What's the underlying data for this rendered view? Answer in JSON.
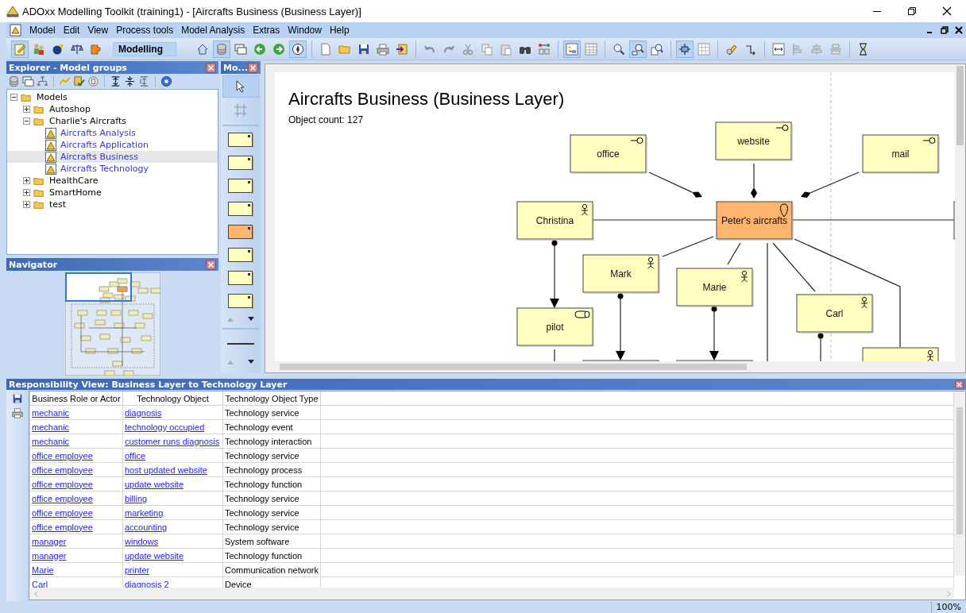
{
  "window": {
    "title": "ADOxx Modelling Toolkit (training1) - [Aircrafts Business (Business Layer)]"
  },
  "menu": [
    "Model",
    "Edit",
    "View",
    "Process tools",
    "Model Analysis",
    "Extras",
    "Window",
    "Help"
  ],
  "toolbar": [
    {
      "kind": "buttons",
      "items": [
        {
          "pressed": true
        },
        {
          "pressed": false
        },
        {
          "pressed": false
        },
        {
          "pressed": false
        },
        {
          "pressed": false
        }
      ]
    },
    {
      "kind": "mode",
      "label": "Modelling"
    },
    {
      "kind": "buttons",
      "items": [
        {
          "pressed": false
        },
        {
          "pressed": true
        },
        {
          "pressed": false
        },
        {
          "pressed": false
        },
        {
          "pressed": false
        },
        {
          "pressed": true
        }
      ]
    },
    {
      "kind": "buttons",
      "items": [
        {
          "pressed": false
        },
        {
          "pressed": false
        },
        {
          "pressed": false
        },
        {
          "pressed": false
        },
        {
          "pressed": false
        }
      ]
    },
    {
      "kind": "buttons",
      "items": [
        {
          "pressed": false
        },
        {
          "pressed": false
        },
        {
          "pressed": false
        },
        {
          "pressed": false
        },
        {
          "pressed": false
        },
        {
          "pressed": false
        },
        {
          "pressed": false
        }
      ]
    },
    {
      "kind": "buttons",
      "items": [
        {
          "pressed": true
        },
        {
          "pressed": false
        }
      ]
    },
    {
      "kind": "buttons",
      "items": [
        {
          "pressed": false
        },
        {
          "pressed": true
        },
        {
          "pressed": false
        }
      ]
    },
    {
      "kind": "buttons",
      "items": [
        {
          "pressed": true
        },
        {
          "pressed": false
        }
      ]
    },
    {
      "kind": "buttons",
      "items": [
        {
          "pressed": false
        },
        {
          "pressed": false
        }
      ]
    },
    {
      "kind": "buttons",
      "items": [
        {
          "pressed": false
        },
        {
          "pressed": false
        },
        {
          "pressed": false
        },
        {
          "pressed": false
        }
      ]
    },
    {
      "kind": "buttons",
      "items": [
        {
          "pressed": false
        }
      ]
    }
  ],
  "explorer": {
    "title": "Explorer - Model groups",
    "tree": [
      {
        "label": "Models",
        "kind": "folder",
        "expanded": true,
        "selected": false,
        "children": [
          {
            "label": "Autoshop",
            "kind": "folder",
            "expanded": false,
            "selected": false
          },
          {
            "label": "Charlie's Aircrafts",
            "kind": "folder",
            "expanded": true,
            "selected": false,
            "children": [
              {
                "label": "Aircrafts Analysis",
                "kind": "model",
                "selected": false
              },
              {
                "label": "Aircrafts Application",
                "kind": "model",
                "selected": false
              },
              {
                "label": "Aircrafts Business",
                "kind": "model",
                "selected": true
              },
              {
                "label": "Aircrafts Technology",
                "kind": "model",
                "selected": false
              }
            ]
          },
          {
            "label": "HealthCare",
            "kind": "folder",
            "expanded": false,
            "selected": false
          },
          {
            "label": "SmartHome",
            "kind": "folder",
            "expanded": false,
            "selected": false
          },
          {
            "label": "test",
            "kind": "folder",
            "expanded": false,
            "selected": false
          }
        ]
      }
    ]
  },
  "navigator": {
    "title": "Navigator"
  },
  "palette": {
    "title": "Mo...",
    "tools": [
      {
        "kind": "pointer",
        "selected": true
      },
      {
        "kind": "grid",
        "selected": false
      },
      {
        "kind": "element",
        "selected": false,
        "color": "#ffffc0"
      },
      {
        "kind": "element",
        "selected": false,
        "color": "#ffffc0"
      },
      {
        "kind": "element",
        "selected": false,
        "color": "#ffffc0"
      },
      {
        "kind": "element",
        "selected": false,
        "color": "#ffffc0"
      },
      {
        "kind": "element",
        "selected": false,
        "color": "#fdb46e"
      },
      {
        "kind": "element",
        "selected": false,
        "color": "#ffffc0"
      },
      {
        "kind": "element",
        "selected": false,
        "color": "#ffffc0"
      },
      {
        "kind": "element",
        "selected": false,
        "color": "#ffffc0"
      },
      {
        "kind": "line",
        "selected": false
      }
    ]
  },
  "diagram": {
    "title": "Aircrafts Business (Business Layer)",
    "subtitle": "Object count: 127",
    "nodes": [
      {
        "label": "office",
        "kind": "service",
        "color": "#ffffc0"
      },
      {
        "label": "website",
        "kind": "service",
        "color": "#ffffc0"
      },
      {
        "label": "mail",
        "kind": "service",
        "color": "#ffffc0"
      },
      {
        "label": "Christina",
        "kind": "actor",
        "color": "#ffffc0"
      },
      {
        "label": "Peter's aircrafts",
        "kind": "location",
        "color": "#fdb46e"
      },
      {
        "label": "Mark",
        "kind": "actor",
        "color": "#ffffc0"
      },
      {
        "label": "Marie",
        "kind": "actor",
        "color": "#ffffc0"
      },
      {
        "label": "pilot",
        "kind": "role",
        "color": "#ffffc0"
      },
      {
        "label": "Carl",
        "kind": "actor",
        "color": "#ffffc0"
      },
      {
        "kind": "actor",
        "color": "#ffffc0"
      },
      {
        "kind": "box"
      },
      {
        "kind": "box"
      },
      {
        "kind": "box"
      }
    ],
    "connections": [
      {
        "kind": "aggregation"
      },
      {
        "kind": "aggregation"
      },
      {
        "kind": "aggregation"
      },
      {
        "kind": "association"
      },
      {
        "kind": "association"
      },
      {
        "kind": "association"
      },
      {
        "kind": "association"
      },
      {
        "kind": "association"
      },
      {
        "kind": "association"
      },
      {
        "kind": "association"
      },
      {
        "kind": "assignment"
      },
      {
        "kind": "assignment"
      },
      {
        "kind": "assignment"
      },
      {
        "kind": "assignment"
      },
      {
        "kind": "association"
      }
    ]
  },
  "responsibility_view": {
    "title": "Responsibility View: Business Layer to Technology Layer",
    "columns": [
      "Business Role or Actor",
      "Technology Object",
      "Technology Object Type"
    ],
    "rows": [
      {
        "role": "mechanic",
        "object": "diagnosis",
        "type": "Technology service"
      },
      {
        "role": "mechanic",
        "object": "technology occupied",
        "type": "Technology event"
      },
      {
        "role": "mechanic",
        "object": "customer runs diagnosis",
        "type": "Technology interaction"
      },
      {
        "role": "office employee",
        "object": "office",
        "type": "Technology service"
      },
      {
        "role": "office employee",
        "object": "host updated website",
        "type": "Technology process"
      },
      {
        "role": "office employee",
        "object": "update website",
        "type": "Technology function"
      },
      {
        "role": "office employee",
        "object": "billing",
        "type": "Technology service"
      },
      {
        "role": "office employee",
        "object": "marketing",
        "type": "Technology service"
      },
      {
        "role": "office employee",
        "object": "accounting",
        "type": "Technology service"
      },
      {
        "role": "manager",
        "object": "windows",
        "type": "System software"
      },
      {
        "role": "manager",
        "object": "update website",
        "type": "Technology function"
      },
      {
        "role": "Marie",
        "object": "printer",
        "type": "Communication network"
      },
      {
        "role": "Carl",
        "object": "diagnosis 2",
        "type": "Device"
      }
    ]
  },
  "status_bar": {
    "zoom": "100%"
  }
}
